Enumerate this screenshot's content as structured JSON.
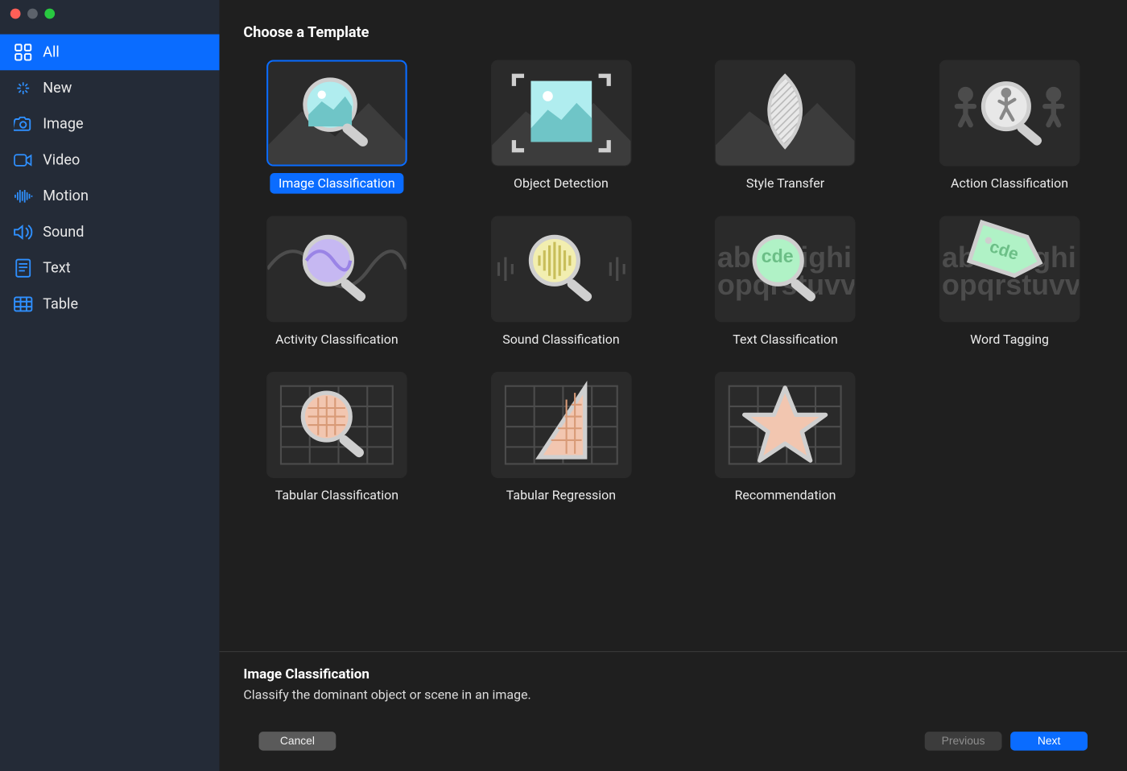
{
  "header": {
    "title": "Choose a Template"
  },
  "sidebar": {
    "items": [
      {
        "label": "All",
        "icon": "grid-icon"
      },
      {
        "label": "New",
        "icon": "sparkle-icon"
      },
      {
        "label": "Image",
        "icon": "camera-icon"
      },
      {
        "label": "Video",
        "icon": "video-icon"
      },
      {
        "label": "Motion",
        "icon": "waveform-icon"
      },
      {
        "label": "Sound",
        "icon": "speaker-icon"
      },
      {
        "label": "Text",
        "icon": "document-icon"
      },
      {
        "label": "Table",
        "icon": "table-icon"
      }
    ],
    "selected_index": 0
  },
  "templates": [
    {
      "label": "Image Classification",
      "selected": true
    },
    {
      "label": "Object Detection",
      "selected": false
    },
    {
      "label": "Style Transfer",
      "selected": false
    },
    {
      "label": "Action Classification",
      "selected": false
    },
    {
      "label": "Activity Classification",
      "selected": false
    },
    {
      "label": "Sound Classification",
      "selected": false
    },
    {
      "label": "Text Classification",
      "selected": false
    },
    {
      "label": "Word Tagging",
      "selected": false
    },
    {
      "label": "Tabular Classification",
      "selected": false
    },
    {
      "label": "Tabular Regression",
      "selected": false
    },
    {
      "label": "Recommendation",
      "selected": false
    }
  ],
  "description": {
    "title": "Image Classification",
    "text": "Classify the dominant object or scene in an image."
  },
  "buttons": {
    "cancel": "Cancel",
    "previous": "Previous",
    "next": "Next"
  },
  "colors": {
    "accent": "#0a6cff",
    "sidebar_bg": "#242b37",
    "main_bg": "#1f1f1f",
    "text_bg0": "#5b8181",
    "text_bg1": "#7a4d7a",
    "text_bg2": "#5b6f8f"
  }
}
